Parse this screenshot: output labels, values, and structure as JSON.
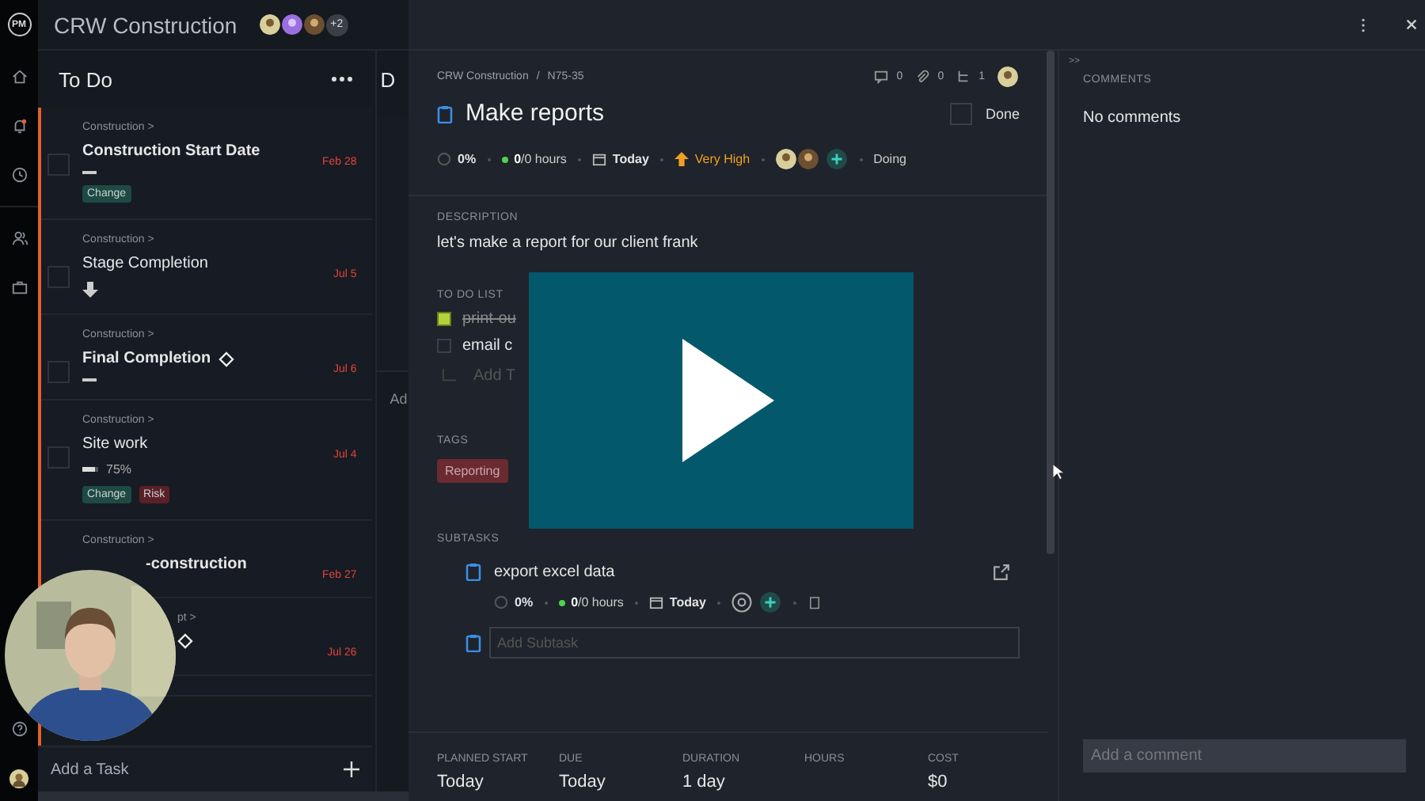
{
  "app": {
    "logo": "PM",
    "project_title": "CRW Construction",
    "extra_members": "+2"
  },
  "column": {
    "title": "To Do",
    "cards": [
      {
        "category": "Construction >",
        "title": "Construction Start Date",
        "date": "Feb 28",
        "checked": false,
        "bold": true,
        "milestone": false,
        "kind": "dash",
        "tags": [
          {
            "label": "Change",
            "color": "#1d4a44"
          }
        ]
      },
      {
        "category": "Construction >",
        "title": "Stage Completion",
        "date": "Jul 5",
        "checked": false,
        "bold": false,
        "milestone": false,
        "kind": "arrow"
      },
      {
        "category": "Construction >",
        "title": "Final Completion",
        "date": "Jul 6",
        "checked": false,
        "bold": true,
        "milestone": true,
        "kind": "dash"
      },
      {
        "category": "Construction >",
        "title": "Site work",
        "date": "Jul 4",
        "checked": false,
        "bold": false,
        "milestone": false,
        "level": 0.75,
        "progress": "75%",
        "tags": [
          {
            "label": "Change",
            "color": "#1d4a44"
          },
          {
            "label": "Risk",
            "color": "#5a1f27"
          }
        ]
      },
      {
        "category": "Construction >",
        "title": "-construction",
        "date": "Feb 27",
        "bold": true
      },
      {
        "category": "pt >",
        "date": "Jul 26",
        "milestone": true
      }
    ],
    "add_task": "Add a Task"
  },
  "next_column": {
    "title": "D",
    "add_label": "Ad"
  },
  "task": {
    "project": "CRW Construction",
    "separator": "/",
    "id": "N75-35",
    "comment_count": "0",
    "attachment_count": "0",
    "subtask_count": "1",
    "title": "Make reports",
    "done_label": "Done",
    "done": false,
    "progress": "0%",
    "hours": "**0**/0 hours",
    "due": "Today",
    "priority": "Very High",
    "status": "Doing",
    "description_label": "DESCRIPTION",
    "description": "let's make a report for our client frank",
    "todo_label": "TO DO LIST",
    "todos": [
      {
        "text": "print-ou",
        "checked": true
      },
      {
        "text": "email c",
        "checked": false
      }
    ],
    "add_todo": "Add T",
    "tags_label": "TAGS",
    "tags": [
      {
        "label": "Reporting",
        "color": "#6b2a30"
      }
    ],
    "subtasks_label": "SUBTASKS",
    "subtasks": [
      {
        "title": "export excel data",
        "progress": "0%",
        "hours": "**0**/0 hours",
        "due": "Today"
      }
    ],
    "add_subtask_placeholder": "Add Subtask",
    "fields": [
      {
        "label": "PLANNED START",
        "value": "Today"
      },
      {
        "label": "DUE",
        "value": "Today"
      },
      {
        "label": "DURATION",
        "value": "1 day"
      },
      {
        "label": "HOURS"
      },
      {
        "label": "COST",
        "value": "$0"
      }
    ]
  },
  "comments": {
    "collapse": ">>",
    "label": "COMMENTS",
    "empty": "No comments",
    "placeholder": "Add a comment"
  }
}
